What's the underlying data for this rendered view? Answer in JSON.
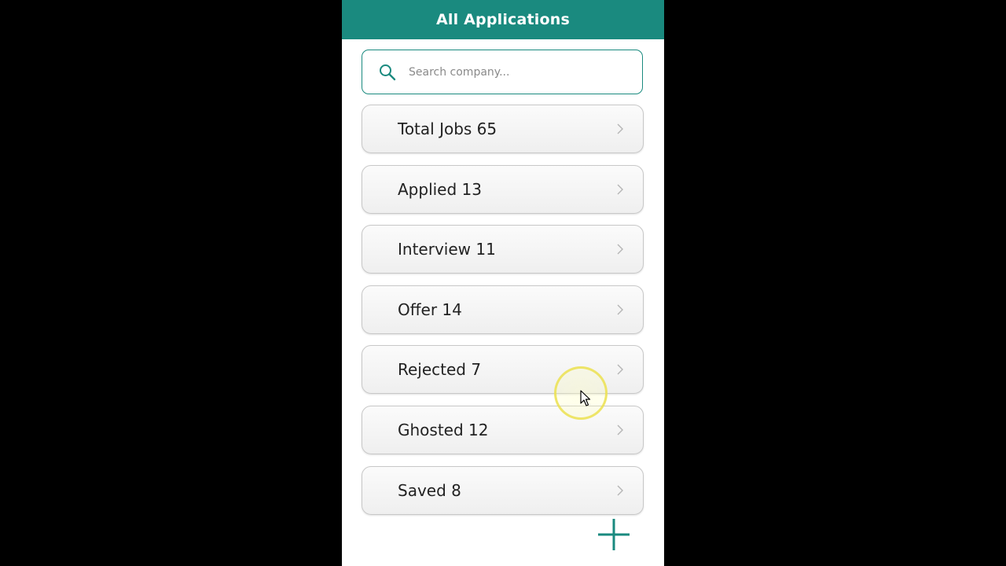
{
  "header": {
    "title": "All Applications"
  },
  "search": {
    "placeholder": "Search company...",
    "value": "",
    "icon": "search-icon"
  },
  "categories": [
    {
      "label": "Total Jobs 65",
      "icon": "chevron-right-icon"
    },
    {
      "label": "Applied 13",
      "icon": "chevron-right-icon"
    },
    {
      "label": "Interview 11",
      "icon": "chevron-right-icon"
    },
    {
      "label": "Offer 14",
      "icon": "chevron-right-icon"
    },
    {
      "label": "Rejected 7",
      "icon": "chevron-right-icon"
    },
    {
      "label": "Ghosted 12",
      "icon": "chevron-right-icon"
    },
    {
      "label": "Saved 8",
      "icon": "chevron-right-icon"
    }
  ],
  "add_button": {
    "icon": "plus-icon"
  },
  "colors": {
    "accent": "#1a8a7f",
    "background": "#000000",
    "card_border": "#c8c8c8",
    "cursor_highlight": "#ebe150"
  }
}
